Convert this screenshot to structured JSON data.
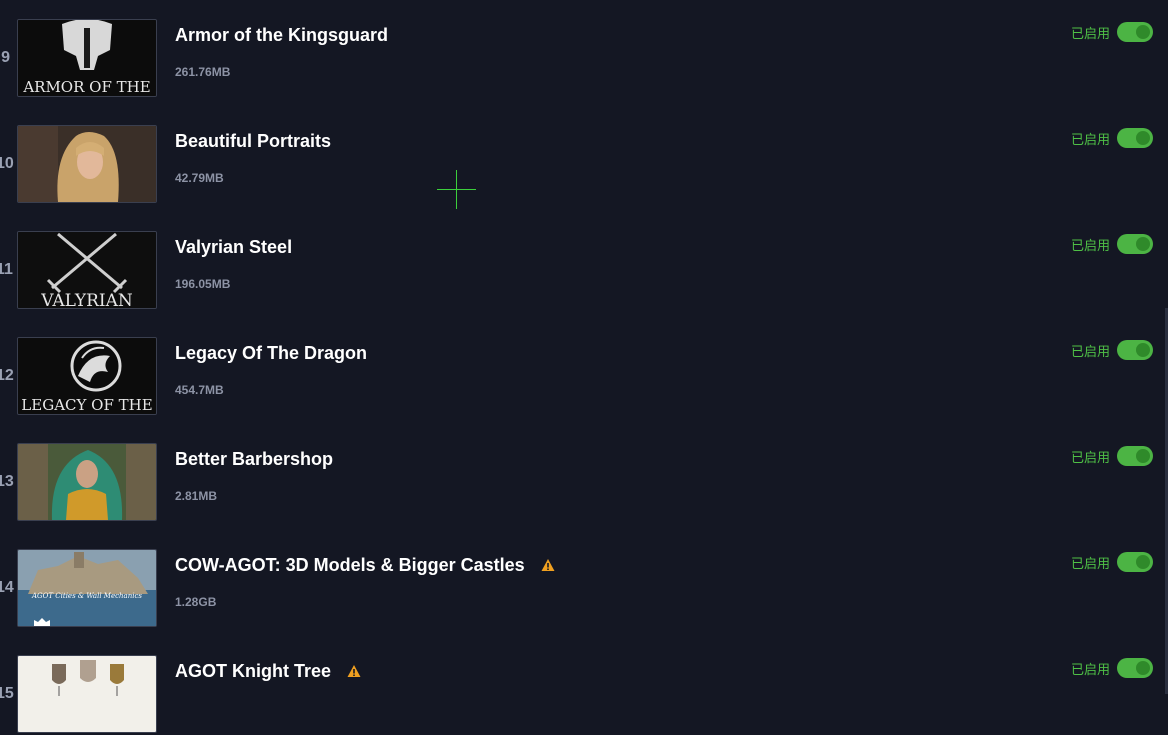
{
  "mods": [
    {
      "index": "9",
      "title": "Armor of the Kingsguard",
      "size": "261.76MB",
      "status": "已启用",
      "enabled": true,
      "warning": false,
      "thumb_text": "ARMOR OF THE"
    },
    {
      "index": "10",
      "title": "Beautiful Portraits",
      "size": "42.79MB",
      "status": "已启用",
      "enabled": true,
      "warning": false,
      "thumb_text": ""
    },
    {
      "index": "11",
      "title": "Valyrian Steel",
      "size": "196.05MB",
      "status": "已启用",
      "enabled": true,
      "warning": false,
      "thumb_text": "VALYRIAN"
    },
    {
      "index": "12",
      "title": "Legacy Of The Dragon",
      "size": "454.7MB",
      "status": "已启用",
      "enabled": true,
      "warning": false,
      "thumb_text": "LEGACY OF THE"
    },
    {
      "index": "13",
      "title": "Better Barbershop",
      "size": "2.81MB",
      "status": "已启用",
      "enabled": true,
      "warning": false,
      "thumb_text": ""
    },
    {
      "index": "14",
      "title": "COW-AGOT: 3D Models & Bigger Castles",
      "size": "1.28GB",
      "status": "已启用",
      "enabled": true,
      "warning": true,
      "thumb_text": "AGOT Cities & Wall Mechanics"
    },
    {
      "index": "15",
      "title": "AGOT Knight Tree",
      "size": "",
      "status": "已启用",
      "enabled": true,
      "warning": true,
      "thumb_text": ""
    }
  ],
  "colors": {
    "background": "#141723",
    "status_green": "#4fc046",
    "toggle_on": "#4cb444",
    "warning": "#f0a020",
    "crosshair": "#3ccf3c"
  },
  "icons": {
    "warning": "warning-triangle-icon",
    "cursor": "crosshair-cursor-icon"
  }
}
